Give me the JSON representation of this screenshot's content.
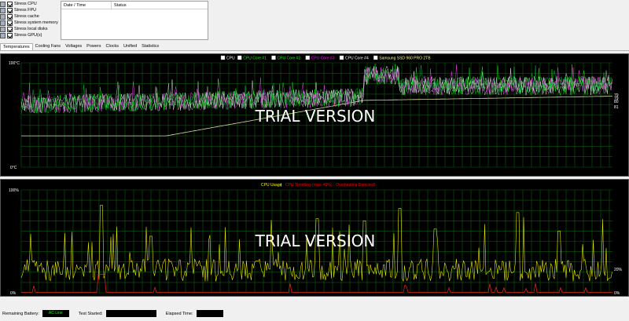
{
  "stress_options": [
    {
      "label": "Stress CPU",
      "icon": "cpu-icon",
      "checked": true
    },
    {
      "label": "Stress FPU",
      "icon": "fpu-icon",
      "checked": true
    },
    {
      "label": "Stress cache",
      "icon": "cache-icon",
      "checked": true
    },
    {
      "label": "Stress system memory",
      "icon": "memory-icon",
      "checked": true
    },
    {
      "label": "Stress local disks",
      "icon": "disk-icon",
      "checked": true
    },
    {
      "label": "Stress GPU(s)",
      "icon": "gpu-icon",
      "checked": true
    }
  ],
  "log_table": {
    "col_date": "Date / Time",
    "col_status": "Status"
  },
  "tabs": [
    "Temperatures",
    "Cooling Fans",
    "Voltages",
    "Powers",
    "Clocks",
    "Unified",
    "Statistics"
  ],
  "active_tab": "Temperatures",
  "temp_graph": {
    "legend": [
      {
        "label": "CPU",
        "color": "#ffffff"
      },
      {
        "label": "CPU Core #1",
        "color": "#00ff00"
      },
      {
        "label": "CPU Core #2",
        "color": "#00ff00"
      },
      {
        "label": "CPU Core #3",
        "color": "#ff00ff"
      },
      {
        "label": "CPU Core #4",
        "color": "#ffffff"
      },
      {
        "label": "Samsung SSD 960 PRO 2TB",
        "color": "#ffff99"
      }
    ],
    "y_top": "100°C",
    "y_bottom": "0°C",
    "right_values": [
      "79",
      "79",
      "80",
      "81"
    ],
    "watermark": "TRIAL VERSION"
  },
  "cpu_graph": {
    "title": "CPU Usage",
    "title_color": "#ffff00",
    "throttle_text": "CPU Throttling (max: 49%) - Overheating Detected!",
    "throttle_color": "#ff0000",
    "y_top": "100%",
    "y_bottom": "0%",
    "right_top": "20%",
    "right_bottom": "0%",
    "watermark": "TRIAL VERSION"
  },
  "status_bar": {
    "battery_label": "Remaining Battery:",
    "battery_value": "AC Line",
    "started_label": "Test Started:",
    "started_value": "",
    "elapsed_label": "Elapsed Time:",
    "elapsed_value": ""
  }
}
